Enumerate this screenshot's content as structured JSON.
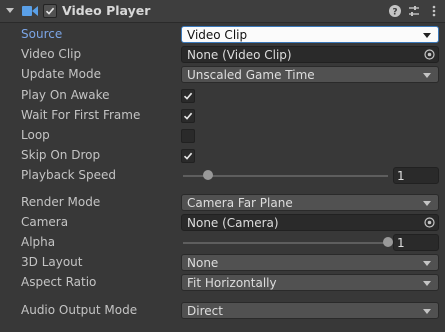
{
  "component": {
    "title": "Video Player",
    "icon": "video-player-icon",
    "enabled": true,
    "header_icons": [
      "help-icon",
      "presets-icon",
      "more-menu-icon"
    ]
  },
  "colors": {
    "background": "#383838",
    "header": "#3e3e3e",
    "focus_label": "#7ba5e6",
    "focus_border": "#3a79bb"
  },
  "fields": {
    "source": {
      "label": "Source",
      "value": "Video Clip"
    },
    "video_clip": {
      "label": "Video Clip",
      "value": "None (Video Clip)"
    },
    "update_mode": {
      "label": "Update Mode",
      "value": "Unscaled Game Time"
    },
    "play_on_awake": {
      "label": "Play On Awake",
      "checked": true
    },
    "wait_first_frame": {
      "label": "Wait For First Frame",
      "checked": true
    },
    "loop": {
      "label": "Loop",
      "checked": false
    },
    "skip_on_drop": {
      "label": "Skip On Drop",
      "checked": true
    },
    "playback_speed": {
      "label": "Playback Speed",
      "value": "1",
      "slider_fraction": 0.12
    },
    "render_mode": {
      "label": "Render Mode",
      "value": "Camera Far Plane"
    },
    "camera": {
      "label": "Camera",
      "value": "None (Camera)"
    },
    "alpha": {
      "label": "Alpha",
      "value": "1",
      "slider_fraction": 1.0
    },
    "layout_3d": {
      "label": "3D Layout",
      "value": "None"
    },
    "aspect_ratio": {
      "label": "Aspect Ratio",
      "value": "Fit Horizontally"
    },
    "audio_output_mode": {
      "label": "Audio Output Mode",
      "value": "Direct"
    }
  }
}
